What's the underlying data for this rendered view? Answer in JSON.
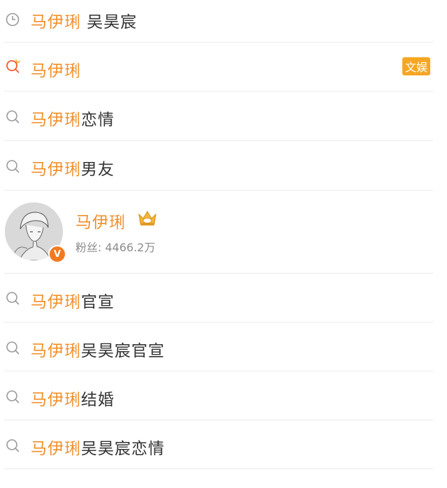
{
  "colors": {
    "keyword": "#f08f2a",
    "text": "#333333",
    "tag_bg": "#f6a623",
    "verify_badge": "#f37a1f",
    "divider": "#ececec",
    "secondary_text": "#8c8c8c"
  },
  "history_item": {
    "icon": "clock-icon",
    "keyword": "马伊琍",
    "rest": " 吴昊宸"
  },
  "trending_item": {
    "icon": "search-hot-icon",
    "keyword": "马伊琍",
    "rest": "",
    "tag": "文娱"
  },
  "suggestions_top": [
    {
      "icon": "search-icon",
      "keyword": "马伊琍",
      "rest": "恋情"
    },
    {
      "icon": "search-icon",
      "keyword": "马伊琍",
      "rest": "男友"
    }
  ],
  "user_card": {
    "name": "马伊琍",
    "fans_label": "粉丝: 4466.2万",
    "verify_mark": "V",
    "crown_icon": "crown-icon"
  },
  "suggestions_bottom": [
    {
      "icon": "search-icon",
      "keyword": "马伊琍",
      "rest": "官宣"
    },
    {
      "icon": "search-icon",
      "keyword": "马伊琍",
      "rest": "吴昊宸官宣"
    },
    {
      "icon": "search-icon",
      "keyword": "马伊琍",
      "rest": "结婚"
    },
    {
      "icon": "search-icon",
      "keyword": "马伊琍",
      "rest": "吴昊宸恋情"
    }
  ]
}
